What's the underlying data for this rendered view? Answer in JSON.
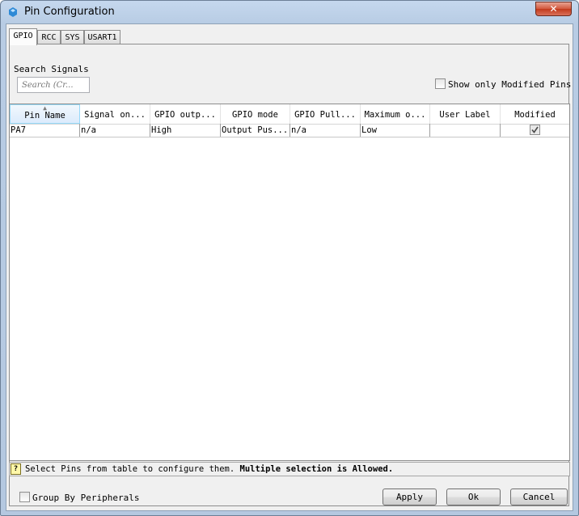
{
  "window": {
    "title": "Pin Configuration",
    "close_glyph": "✕"
  },
  "tabs": [
    {
      "label": "GPIO",
      "active": true
    },
    {
      "label": "RCC",
      "active": false
    },
    {
      "label": "SYS",
      "active": false
    },
    {
      "label": "USART1",
      "active": false
    }
  ],
  "search": {
    "label": "Search Signals",
    "placeholder": "Search (Cr..."
  },
  "show_modified": {
    "label": "Show only Modified Pins",
    "checked": false
  },
  "table": {
    "sort_indicator": "▲",
    "columns": [
      "Pin Name",
      "Signal on...",
      "GPIO outp...",
      "GPIO mode",
      "GPIO Pull...",
      "Maximum o...",
      "User Label",
      "Modified"
    ],
    "rows": [
      {
        "pin": "PA7",
        "signal": "n/a",
        "output": "High",
        "mode": "Output Pus...",
        "pull": "n/a",
        "speed": "Low",
        "label": "",
        "modified": true
      }
    ]
  },
  "status": {
    "help_glyph": "?",
    "text": "Select Pins from table to configure them. ",
    "bold": "Multiple selection is Allowed."
  },
  "footer": {
    "group_label": "Group By Peripherals",
    "group_checked": false,
    "apply": "Apply",
    "ok": "Ok",
    "cancel": "Cancel"
  },
  "colors": {
    "title_bg": "#b9cde5",
    "client_bg": "#f0f0f0",
    "close_red": "#c94a2f",
    "selected_header": "#dcebfc"
  }
}
